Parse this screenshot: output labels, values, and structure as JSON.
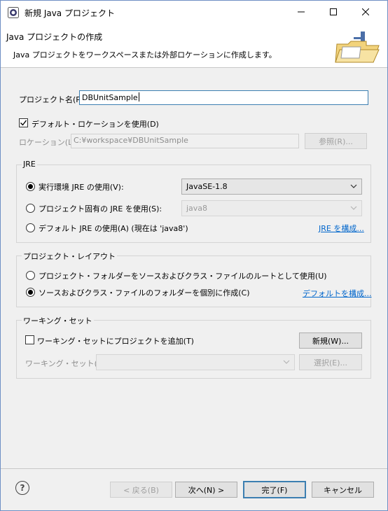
{
  "window": {
    "title": "新規 Java プロジェクト"
  },
  "banner": {
    "heading": "Java プロジェクトの作成",
    "description": "Java プロジェクトをワークスペースまたは外部ロケーションに作成します。"
  },
  "project_name": {
    "label": "プロジェクト名(P):",
    "value": "DBUnitSample"
  },
  "location": {
    "use_default_label": "デフォルト・ロケーションを使用(D)",
    "use_default_checked": true,
    "label": "ロケーション(L):",
    "value": "C:¥workspace¥DBUnitSample",
    "browse_label": "参照(R)..."
  },
  "jre": {
    "group_title": "JRE",
    "use_env_label": "実行環境 JRE の使用(V):",
    "env_value": "JavaSE-1.8",
    "use_project_label": "プロジェクト固有の JRE を使用(S):",
    "project_value": "java8",
    "use_default_label": "デフォルト JRE の使用(A) (現在は 'java8')",
    "configure_link": "JRE を構成...",
    "selected": "env"
  },
  "layout": {
    "group_title": "プロジェクト・レイアウト",
    "root_label": "プロジェクト・フォルダーをソースおよびクラス・ファイルのルートとして使用(U)",
    "separate_label": "ソースおよびクラス・ファイルのフォルダーを個別に作成(C)",
    "configure_link": "デフォルトを構成...",
    "selected": "separate"
  },
  "working_sets": {
    "group_title": "ワーキング・セット",
    "add_label": "ワーキング・セットにプロジェクトを追加(T)",
    "add_checked": false,
    "new_button": "新規(W)...",
    "sets_label": "ワーキング・セット(O):",
    "sets_value": "",
    "select_button": "選択(E)..."
  },
  "footer": {
    "help_glyph": "?",
    "back_button": "< 戻る(B)",
    "next_button": "次へ(N) >",
    "finish_button": "完了(F)",
    "cancel_button": "キャンセル"
  },
  "colors": {
    "accent": "#3c7fb1",
    "link": "#0066cc",
    "dialog_bg": "#f0f0f0"
  }
}
